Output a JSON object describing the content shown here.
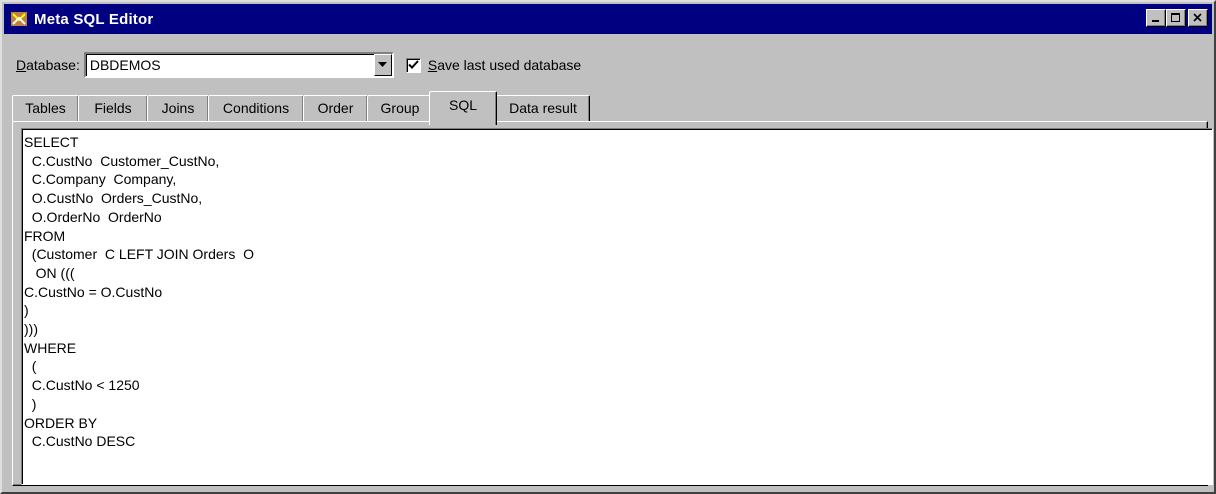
{
  "window": {
    "title": "Meta SQL Editor",
    "icon": "app-icon"
  },
  "database": {
    "label_first": "D",
    "label_rest": "atabase:",
    "value": "DBDEMOS",
    "save_checked": true,
    "save_label_first": "S",
    "save_label_rest": "ave last used database"
  },
  "tabs": [
    {
      "label": "Tables",
      "active": false
    },
    {
      "label": "Fields",
      "active": false
    },
    {
      "label": "Joins",
      "active": false
    },
    {
      "label": "Conditions",
      "active": false
    },
    {
      "label": "Order",
      "active": false
    },
    {
      "label": "Group",
      "active": false
    },
    {
      "label": "SQL",
      "active": true
    },
    {
      "label": "Data result",
      "active": false
    }
  ],
  "sql_lines": [
    "SELECT",
    "  C.CustNo  Customer_CustNo,",
    "  C.Company  Company,",
    "  O.CustNo  Orders_CustNo,",
    "  O.OrderNo  OrderNo",
    "FROM",
    "  (Customer  C LEFT JOIN Orders  O",
    "   ON (((",
    "C.CustNo = O.CustNo",
    ")",
    ")))",
    "WHERE",
    "  (",
    "  C.CustNo < 1250",
    "  )",
    "ORDER BY",
    "  C.CustNo DESC"
  ],
  "colors": {
    "titlebar": "#000080",
    "face": "#c0c0c0"
  }
}
